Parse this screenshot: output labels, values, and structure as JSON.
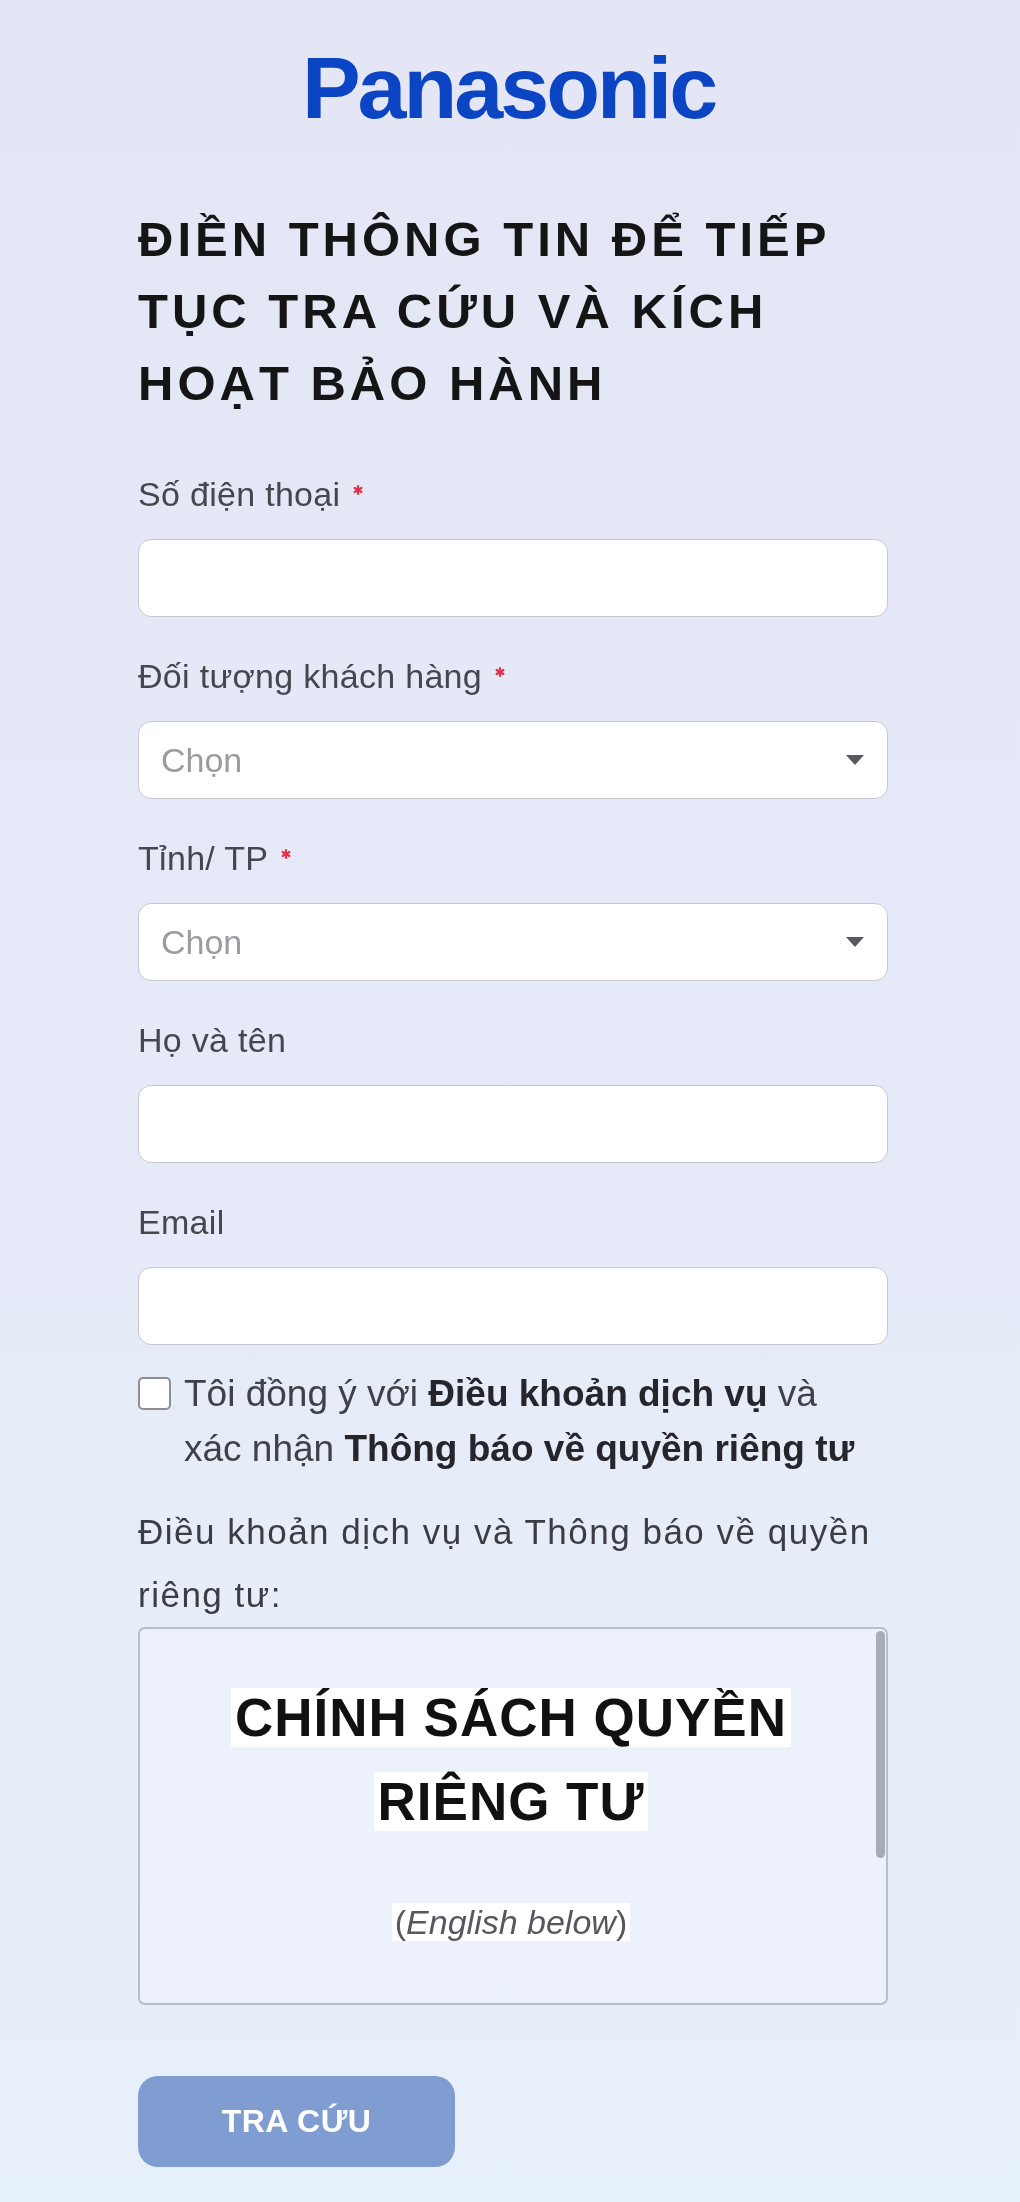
{
  "header": {
    "logo": "Panasonic"
  },
  "title": "ĐIỀN THÔNG TIN ĐỂ TIẾP TỤC TRA CỨU VÀ KÍCH HOẠT BẢO HÀNH",
  "fields": [
    {
      "kind": "text",
      "label": "Số điện thoại",
      "required": true
    },
    {
      "kind": "select",
      "label": "Đối tượng khách hàng",
      "required": true,
      "placeholder": "Chọn"
    },
    {
      "kind": "select",
      "label": "Tỉnh/ TP",
      "required": true,
      "placeholder": "Chọn"
    },
    {
      "kind": "text",
      "label": "Họ và tên",
      "required": false
    },
    {
      "kind": "text",
      "label": "Email",
      "required": false
    }
  ],
  "consent": {
    "checked": false,
    "text": "Tôi đồng ý với **Điều khoản dịch vụ** và xác nhận **Thông báo về quyền riêng tư**"
  },
  "terms": {
    "heading": "Điều khoản dịch vụ và Thông báo về quyền riêng tư:",
    "policy_title": "CHÍNH SÁCH QUYỀN RIÊNG TƯ",
    "policy_note": "(*English below*)"
  },
  "submit": {
    "label": "TRA CỨU",
    "disabled": true
  }
}
